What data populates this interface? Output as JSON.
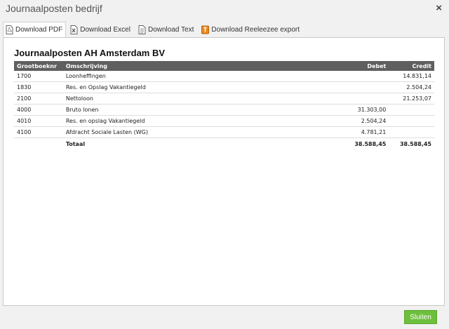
{
  "window": {
    "title": "Journaalposten bedrijf",
    "close_glyph": "×"
  },
  "toolbar": {
    "tabs": [
      {
        "label": "Download PDF",
        "icon": "pdf-file-icon"
      },
      {
        "label": "Download Excel",
        "icon": "excel-file-icon"
      },
      {
        "label": "Download Text",
        "icon": "text-file-icon"
      },
      {
        "label": "Download Reeleezee export",
        "icon": "reeleezee-icon"
      }
    ]
  },
  "report": {
    "title": "Journaalposten AH Amsterdam BV",
    "columns": {
      "account": "Grootboeknr",
      "description": "Omschrijving",
      "debit": "Debet",
      "credit": "Credit"
    },
    "rows": [
      {
        "account": "1700",
        "description": "Loonheffingen",
        "debit": "",
        "credit": "14.831,14"
      },
      {
        "account": "1830",
        "description": "Res. en Opslag Vakantiegeld",
        "debit": "",
        "credit": "2.504,24"
      },
      {
        "account": "2100",
        "description": "Nettoloon",
        "debit": "",
        "credit": "21.253,07"
      },
      {
        "account": "4000",
        "description": "Bruto lonen",
        "debit": "31.303,00",
        "credit": ""
      },
      {
        "account": "4010",
        "description": "Res. en opslag Vakantiegeld",
        "debit": "2.504,24",
        "credit": ""
      },
      {
        "account": "4100",
        "description": "Afdracht Sociale Lasten (WG)",
        "debit": "4.781,21",
        "credit": ""
      }
    ],
    "total": {
      "label": "Totaal",
      "debit": "38.588,45",
      "credit": "38.588,45"
    }
  },
  "footer": {
    "close_label": "Sluiten",
    "close_color": "#6dbf3c"
  }
}
